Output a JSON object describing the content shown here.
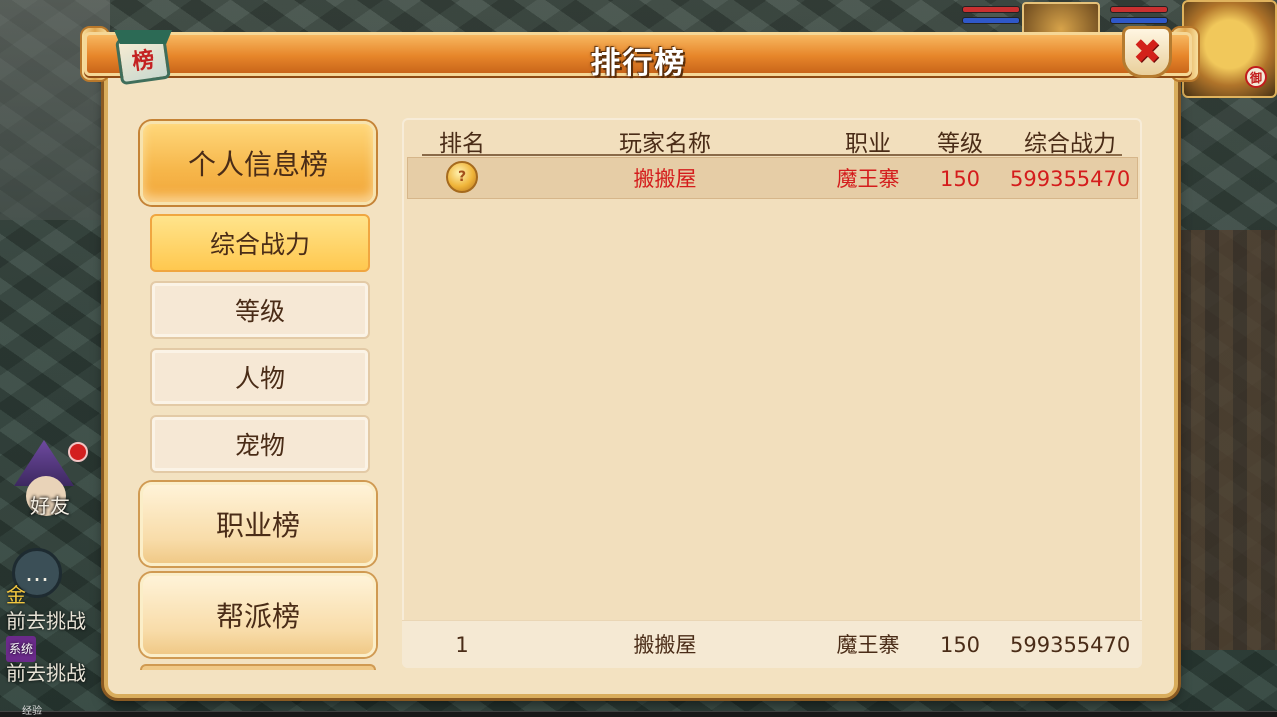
{
  "window": {
    "title": "排行榜",
    "badge_glyph": "榜",
    "close_glyph": "✖"
  },
  "nav": {
    "personal": "个人信息榜",
    "sub_items": [
      "综合战力",
      "等级",
      "人物",
      "宠物"
    ],
    "career": "职业榜",
    "guild": "帮派榜"
  },
  "table": {
    "headers": [
      "排名",
      "玩家名称",
      "职业",
      "等级",
      "综合战力"
    ],
    "rows": [
      {
        "rank_icon": "gold-medal-icon",
        "name": "搬搬屋",
        "job": "魔王寨",
        "level": "150",
        "power": "599355470"
      }
    ],
    "mine": {
      "rank": "1",
      "name": "搬搬屋",
      "job": "魔王寨",
      "level": "150",
      "power": "599355470"
    }
  },
  "background": {
    "friend_label": "好友",
    "chat_gold": "金",
    "chat_lines": [
      "前去挑战",
      "前去挑战"
    ],
    "system_tag": "系统",
    "tiger_badge": "御",
    "exp_label": "经验"
  },
  "colors": {
    "title_orange": "#e7862a",
    "panel_bg": "#f3e2c1",
    "active_tab": "#ffc84f",
    "highlight_red": "#d41c1c",
    "text_brown": "#4a2c17"
  }
}
